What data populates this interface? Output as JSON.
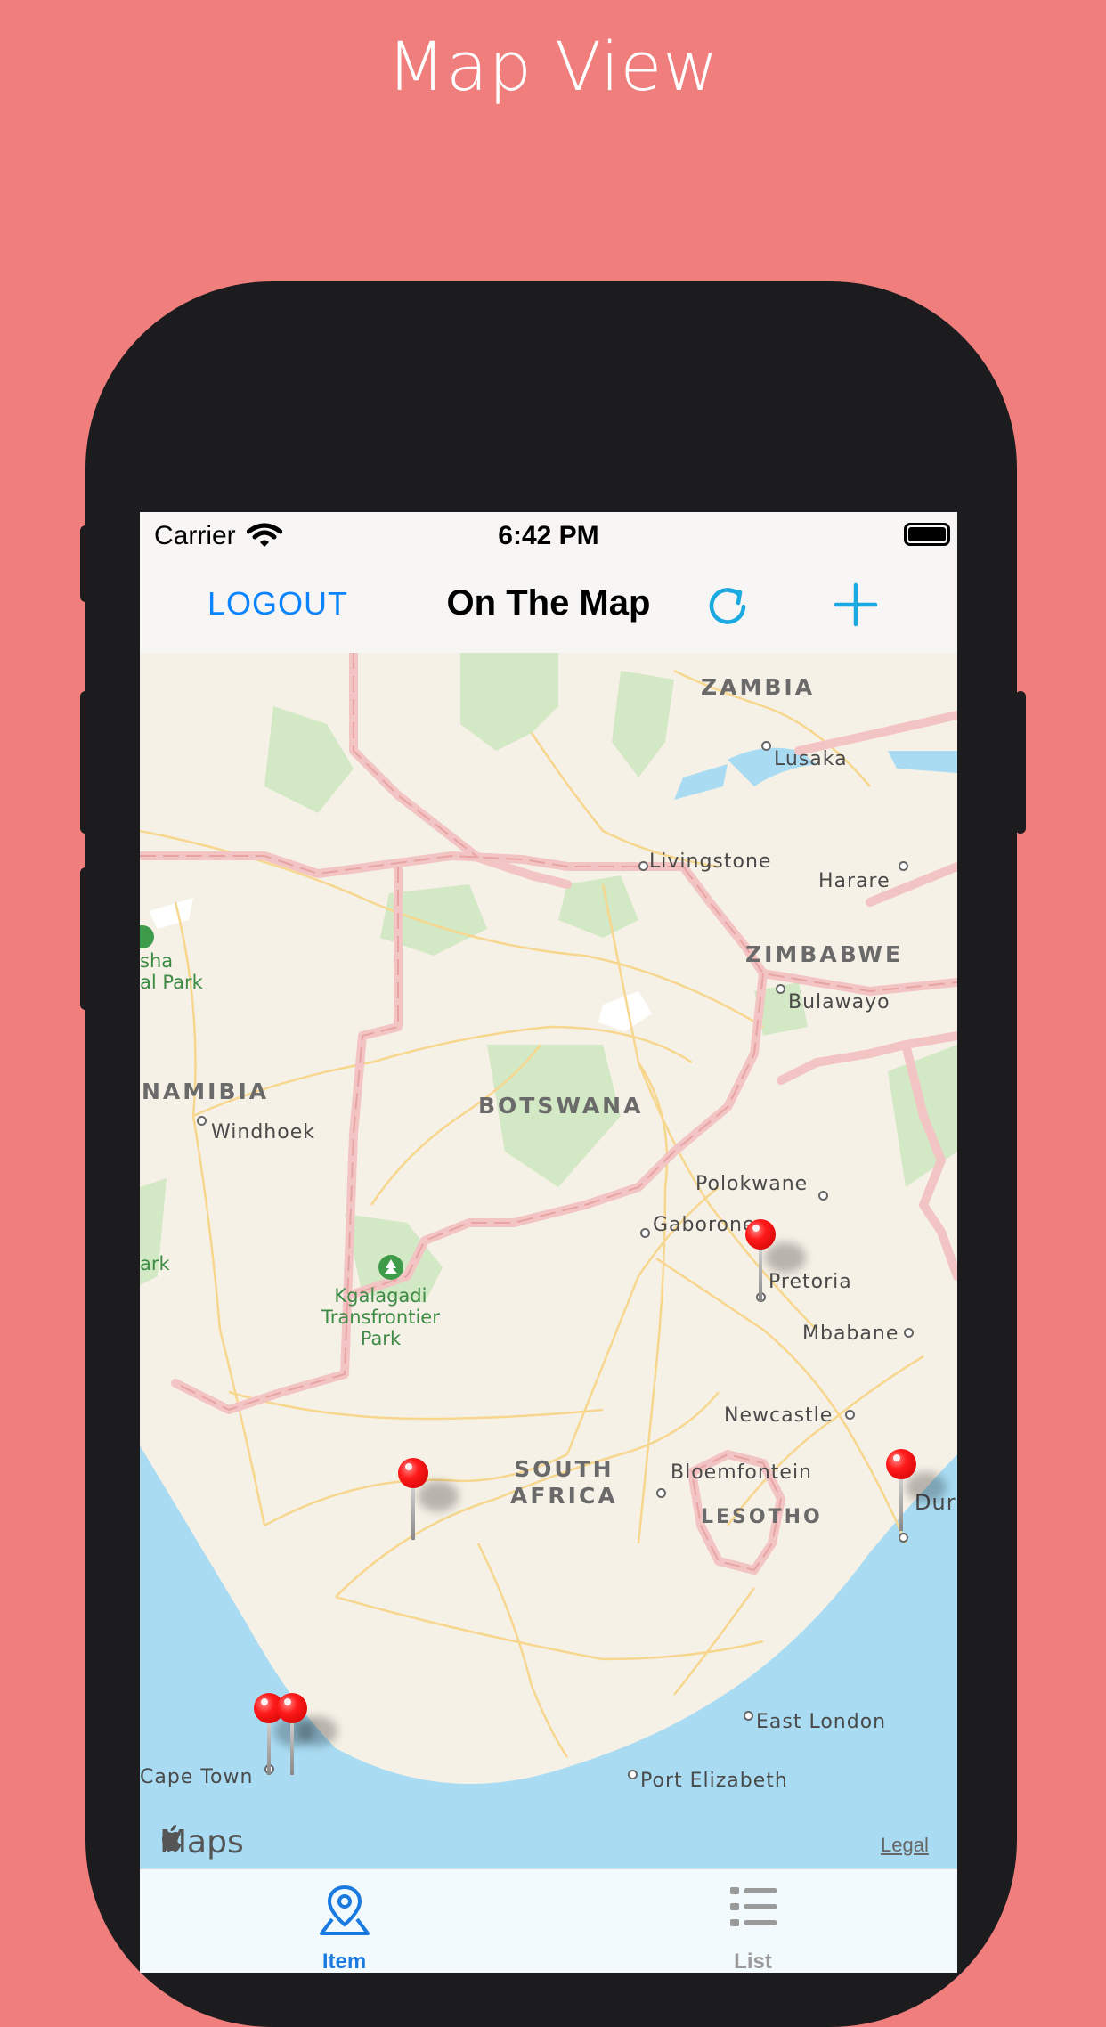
{
  "promo": {
    "title": "Map View"
  },
  "status_bar": {
    "carrier": "Carrier",
    "time": "6:42 PM"
  },
  "nav": {
    "logout_label": "LOGOUT",
    "title": "On The Map",
    "refresh_icon": "refresh-icon",
    "add_icon": "plus-icon"
  },
  "map": {
    "countries": [
      {
        "label": "ZAMBIA"
      },
      {
        "label": "ZIMBABWE"
      },
      {
        "label": "NAMIBIA"
      },
      {
        "label": "BOTSWANA"
      },
      {
        "label": "SOUTH\nAFRICA"
      },
      {
        "label": "LESOTHO"
      }
    ],
    "cities": [
      {
        "label": "Lusaka"
      },
      {
        "label": "Livingstone"
      },
      {
        "label": "Harare"
      },
      {
        "label": "Bulawayo"
      },
      {
        "label": "Windhoek"
      },
      {
        "label": "Polokwane"
      },
      {
        "label": "Gaborone"
      },
      {
        "label": "Pretoria"
      },
      {
        "label": "Mbabane"
      },
      {
        "label": "Newcastle"
      },
      {
        "label": "Bloemfontein"
      },
      {
        "label": "Dur"
      },
      {
        "label": "East London"
      },
      {
        "label": "Port Elizabeth"
      },
      {
        "label": "Cape Town"
      }
    ],
    "parks": [
      {
        "label": "Kgalagadi\nTransfrontier\nPark"
      },
      {
        "label": "sha\nal Park"
      },
      {
        "label": "ark"
      }
    ],
    "maps_label": "Maps",
    "legal_label": "Legal",
    "colors": {
      "water": "#a9dcf3",
      "land": "#f6f1e7",
      "park": "#d3e8c4",
      "border": "#f3c4c4",
      "road": "#f7d68e",
      "pin": "#ff1a1a"
    }
  },
  "tabs": [
    {
      "label": "Item",
      "icon": "map-pin-icon",
      "active": true,
      "color": "#1a7ae0"
    },
    {
      "label": "List",
      "icon": "list-icon",
      "active": false,
      "color": "#9a9a9a"
    }
  ]
}
